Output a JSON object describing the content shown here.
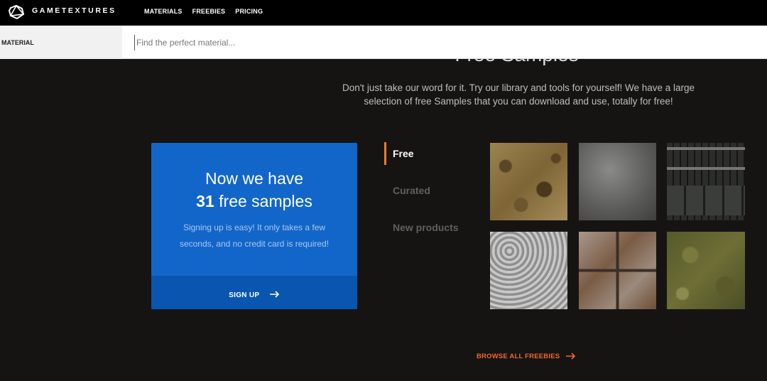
{
  "header": {
    "brand": "GAMETEXTURES",
    "nav": [
      "MATERIALS",
      "FREEBIES",
      "PRICING"
    ]
  },
  "search": {
    "category_label": "MATERIAL",
    "placeholder": "Find the perfect material..."
  },
  "section": {
    "title": "Free Samples",
    "description": "Don't just take our word for it. Try our library and tools for yourself! We have a large selection of free Samples that you can download and use, totally for free!"
  },
  "promo": {
    "line1": "Now we have",
    "count": "31",
    "line2_suffix": " free samples",
    "text": "Signing up is easy! It only takes a few seconds, and no credit card is required!",
    "cta": "SIGN UP"
  },
  "tabs": [
    {
      "label": "Free",
      "active": true
    },
    {
      "label": "Curated",
      "active": false
    },
    {
      "label": "New products",
      "active": false
    }
  ],
  "materials": [
    {
      "icon": "material-thumbnail-mud"
    },
    {
      "icon": "material-thumbnail-concrete"
    },
    {
      "icon": "material-thumbnail-scifi-panel"
    },
    {
      "icon": "material-thumbnail-diamond-plate"
    },
    {
      "icon": "material-thumbnail-rusty-metal"
    },
    {
      "icon": "material-thumbnail-mossy-ground"
    }
  ],
  "browse": "BROWSE ALL FREEBIES",
  "colors": {
    "background": "#161413",
    "card": "#1266c9",
    "accent": "#ee7d2b"
  }
}
